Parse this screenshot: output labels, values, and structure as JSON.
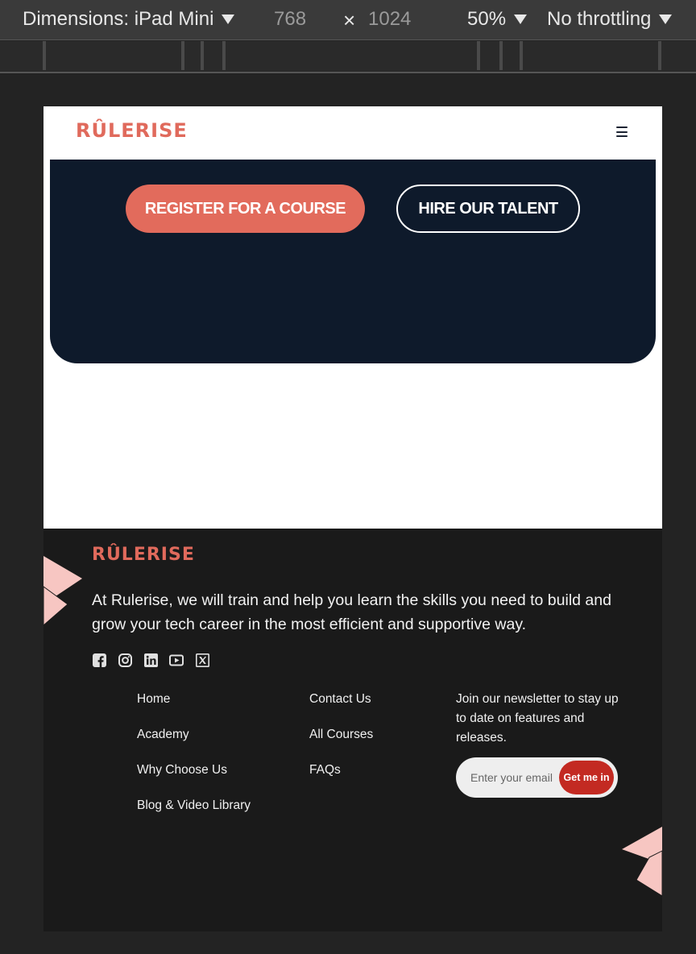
{
  "devtools": {
    "dimensions_label": "Dimensions: iPad Mini",
    "width": "768",
    "times": "×",
    "height": "1024",
    "zoom": "50%",
    "throttling": "No throttling"
  },
  "site": {
    "logo_text": "RÛLERISE",
    "brand_color": "#e06a5c",
    "hero_bg": "#0e1a2b",
    "cta_register": "REGISTER FOR A COURSE",
    "cta_hire": "HIRE OUR TALENT"
  },
  "footer": {
    "logo_text": "RÛLERISE",
    "description": "At Rulerise, we will train and help you learn the skills you need to build and grow your tech career in the most efficient and supportive way.",
    "socials": [
      "facebook-icon",
      "instagram-icon",
      "linkedin-icon",
      "youtube-icon",
      "x-twitter-icon"
    ],
    "links_col1": [
      "Home",
      "Academy",
      "Why Choose Us",
      "Blog & Video Library"
    ],
    "links_col2": [
      "Contact Us",
      "All Courses",
      "FAQs"
    ],
    "newsletter_text": "Join our newsletter to stay up to date on features and releases.",
    "email_placeholder": "Enter your email",
    "newsletter_button": "Get me in",
    "button_color": "#c32a22"
  }
}
